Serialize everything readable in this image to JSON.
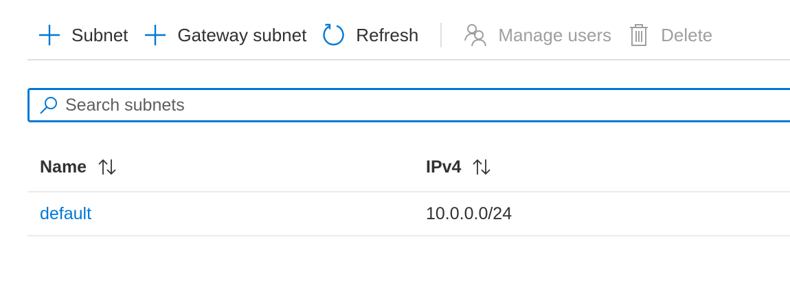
{
  "toolbar": {
    "items": [
      {
        "label": "Subnet",
        "icon": "plus-icon",
        "enabled": true
      },
      {
        "label": "Gateway subnet",
        "icon": "plus-icon",
        "enabled": true
      },
      {
        "label": "Refresh",
        "icon": "refresh-icon",
        "enabled": true
      },
      {
        "label": "Manage users",
        "icon": "users-icon",
        "enabled": false
      },
      {
        "label": "Delete",
        "icon": "trash-icon",
        "enabled": false
      }
    ]
  },
  "search": {
    "placeholder": "Search subnets",
    "value": "",
    "icon": "search-icon"
  },
  "table": {
    "columns": [
      {
        "label": "Name",
        "sortable": true,
        "icon": "sort-icon"
      },
      {
        "label": "IPv4",
        "sortable": true,
        "icon": "sort-icon"
      }
    ],
    "rows": [
      {
        "name": "default",
        "ipv4": "10.0.0.0/24"
      }
    ]
  },
  "colors": {
    "accent": "#0078d4",
    "text": "#323130",
    "disabled": "#a19f9d",
    "divider": "#e1dfdd"
  }
}
